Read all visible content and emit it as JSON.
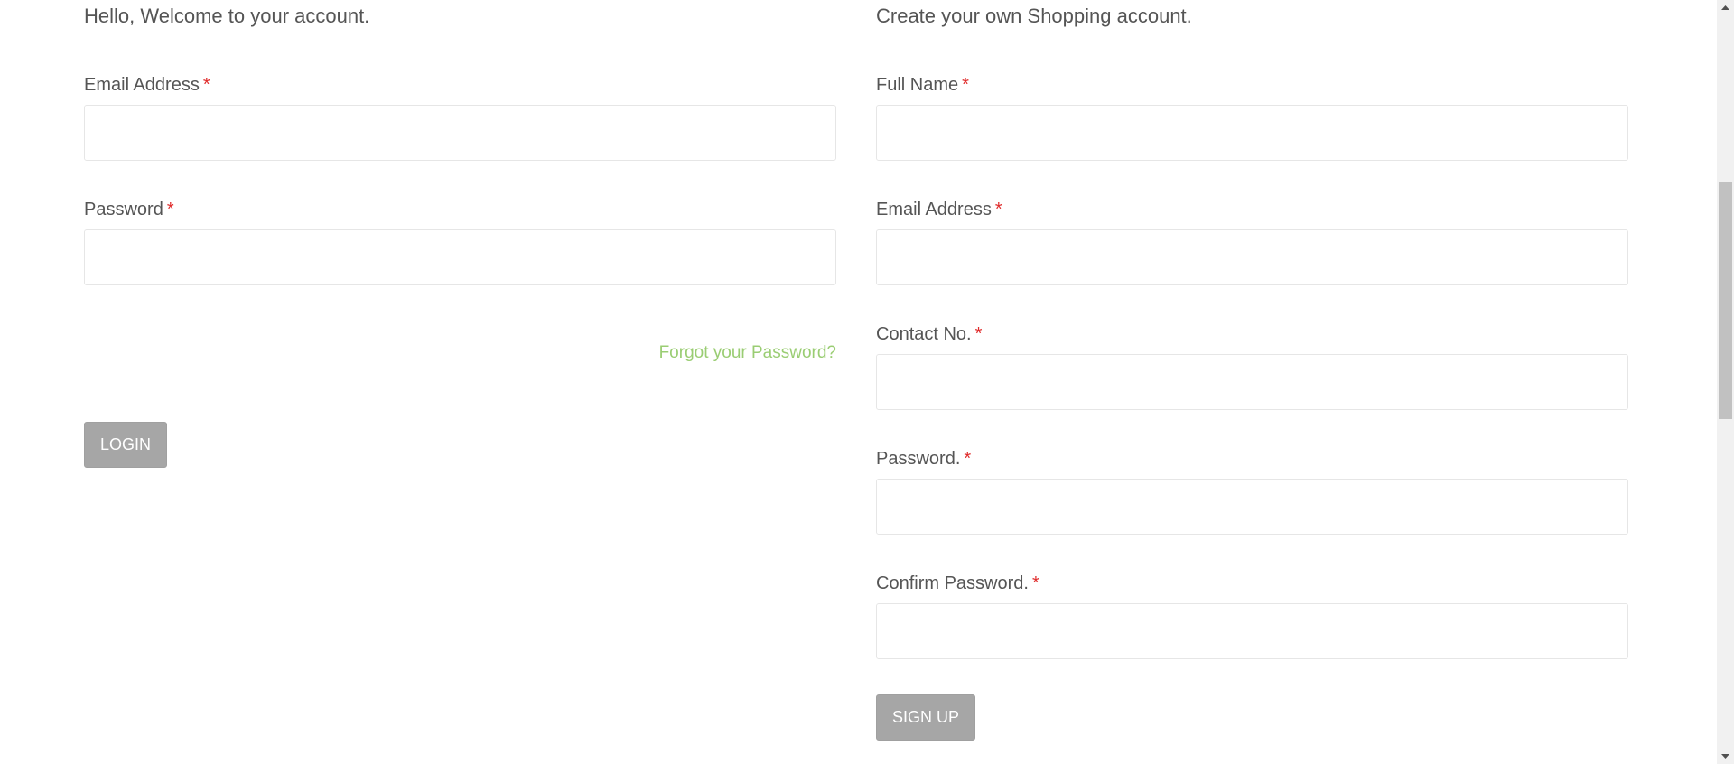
{
  "login": {
    "title": "Hello, Welcome to your account.",
    "email_label": "Email Address",
    "password_label": "Password",
    "required_mark": "*",
    "forgot_link": "Forgot your Password?",
    "login_button": "LOGIN"
  },
  "signup": {
    "title": "Create your own Shopping account.",
    "fullname_label": "Full Name",
    "email_label": "Email Address",
    "contact_label": "Contact No.",
    "password_label": "Password.",
    "confirm_label": "Confirm Password.",
    "required_mark": "*",
    "signup_button": "SIGN UP"
  },
  "colors": {
    "required": "#e02b2b",
    "link": "#9acd73",
    "button": "#a6a6a6"
  },
  "scrollbar": {
    "up_icon": "scroll-up-arrow-icon",
    "down_icon": "scroll-down-arrow-icon"
  }
}
